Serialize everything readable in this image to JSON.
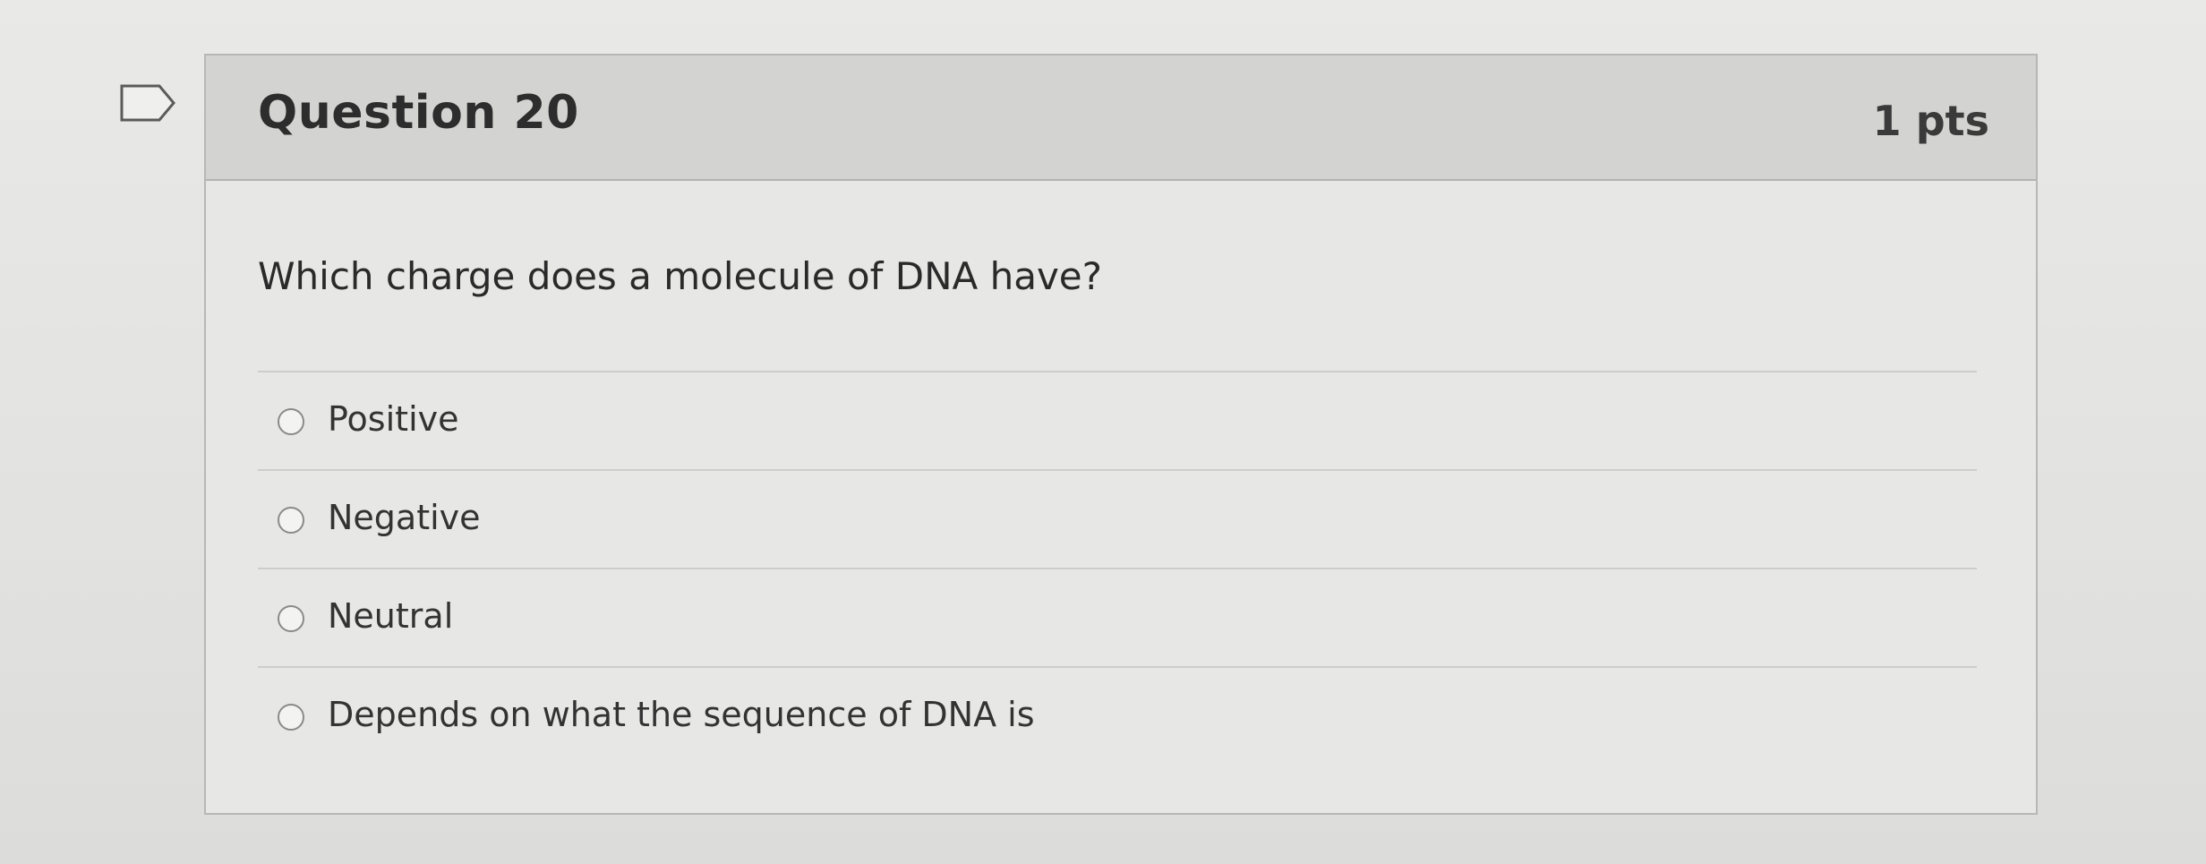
{
  "question": {
    "title": "Question 20",
    "points": "1 pts",
    "text": "Which charge does a molecule of DNA have?",
    "answers": [
      {
        "label": "Positive"
      },
      {
        "label": "Negative"
      },
      {
        "label": "Neutral"
      },
      {
        "label": "Depends on what the sequence of DNA is"
      }
    ]
  },
  "icons": {
    "flag": "flag-icon",
    "radio": "radio-icon"
  },
  "colors": {
    "background": "#e4e4e2",
    "header": "#d3d3d1",
    "text": "#2d2d2d"
  }
}
